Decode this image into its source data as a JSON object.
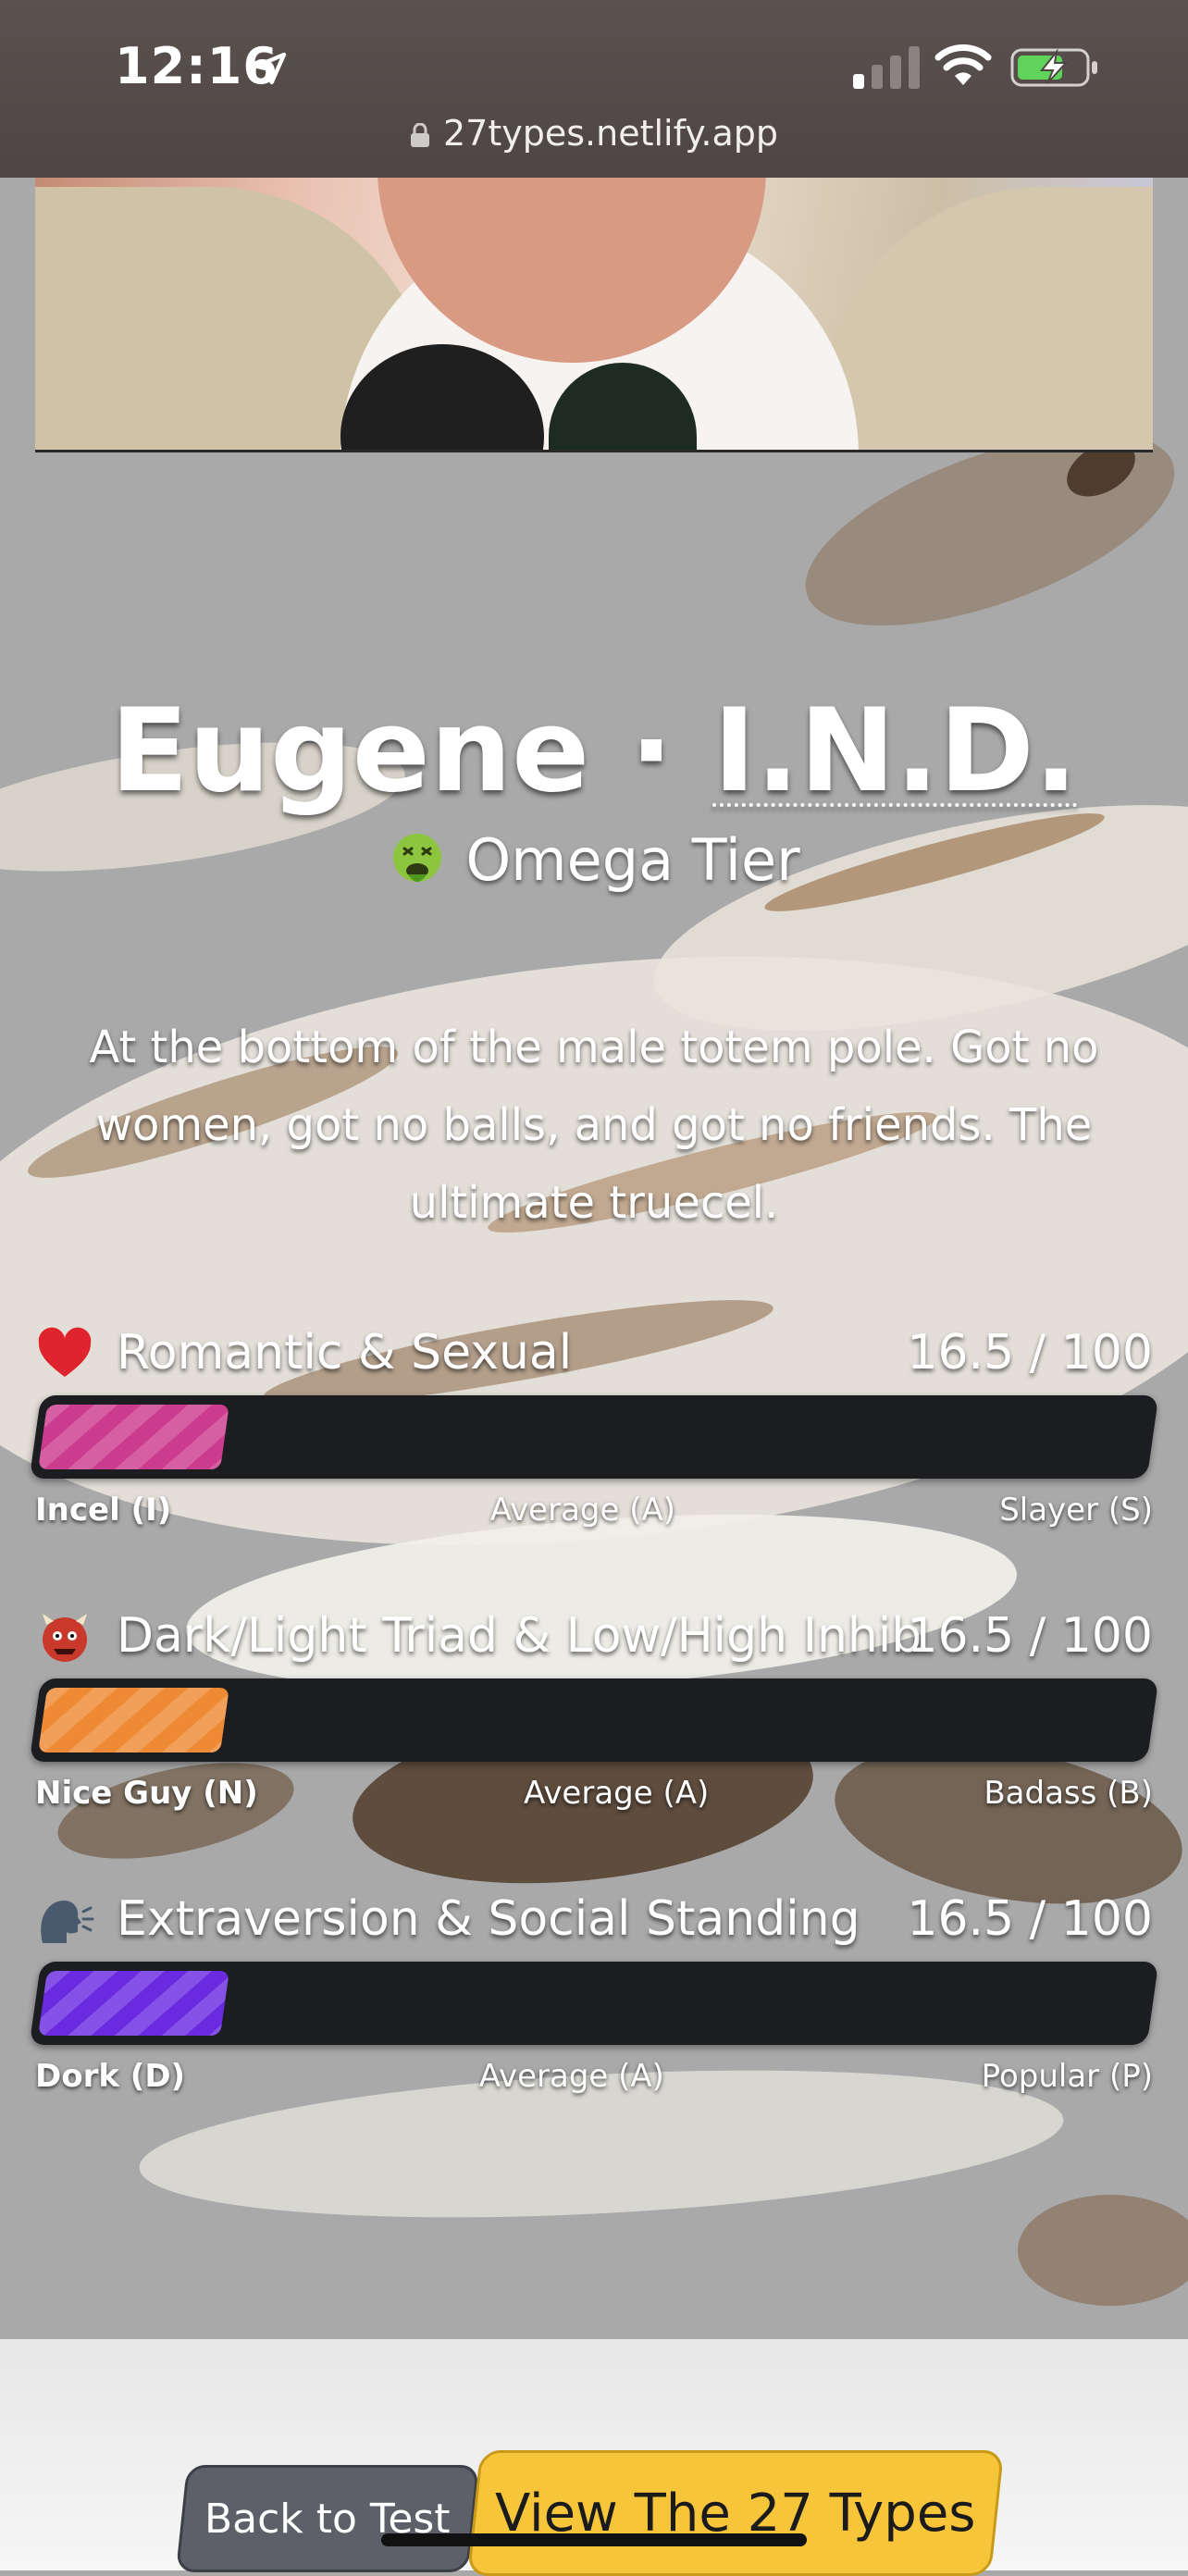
{
  "status_bar": {
    "time": "12:16",
    "url": "27types.netlify.app"
  },
  "result": {
    "name": "Eugene",
    "separator": "·",
    "code": "I.N.D.",
    "tier_emoji": "nauseated-face-emoji",
    "tier": "Omega Tier",
    "description": "At the bottom of the male totem pole. Got no women, got no balls, and got no friends. The ultimate truecel."
  },
  "meters": [
    {
      "icon": "heart-emoji",
      "label": "Romantic & Sexual",
      "score": "16.5 / 100",
      "value": 16.5,
      "color": "#cc3c8e",
      "low": "Incel (I)",
      "mid": "Average (A)",
      "high": "Slayer (S)"
    },
    {
      "icon": "ogre-emoji",
      "label": "Dark/Light Triad & Low/High Inhib",
      "score": "16.5 / 100",
      "value": 16.5,
      "color": "#ee8a34",
      "low": "Nice Guy (N)",
      "mid": "Average (A)",
      "high": "Badass (B)"
    },
    {
      "icon": "speaking-head-emoji",
      "label": "Extraversion & Social Standing",
      "score": "16.5 / 100",
      "value": 16.5,
      "color": "#6a2be0",
      "low": "Dork (D)",
      "mid": "Average (A)",
      "high": "Popular (P)"
    }
  ],
  "actions": {
    "back": "Back to Test",
    "view_types": "View The 27 Types"
  }
}
